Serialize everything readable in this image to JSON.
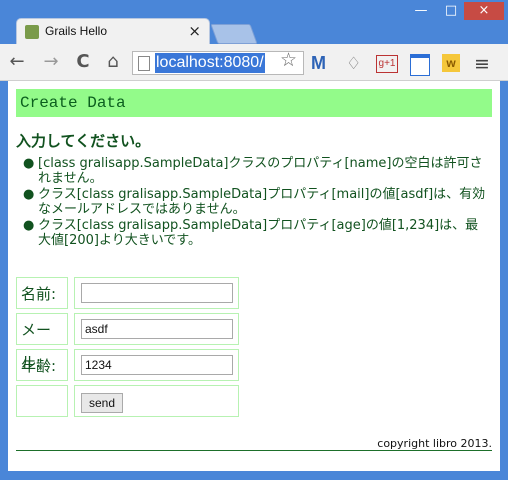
{
  "browser": {
    "tab_title": "Grails Hello",
    "url": "localhost:8080/",
    "menu_labels": {
      "back": "←",
      "forward": "→",
      "reload": "C",
      "home": "⌂",
      "star": "☆",
      "mail": "M",
      "bell": "♢",
      "gplus": "g+1",
      "w": "w",
      "menu": "≡"
    }
  },
  "page": {
    "header": "Create Data",
    "instruction": "入力してください。",
    "errors": [
      "[class gralisapp.SampleData]クラスのプロパティ[name]の空白は許可されません。",
      "クラス[class gralisapp.SampleData]プロパティ[mail]の値[asdf]は、有効なメールアドレスではありません。",
      "クラス[class gralisapp.SampleData]プロパティ[age]の値[1,234]は、最大値[200]より大きいです。"
    ],
    "form": {
      "name_label": "名前:",
      "mail_label": "メール:",
      "age_label": "年齢:",
      "name_value": "",
      "mail_value": "asdf",
      "age_value": "1234",
      "submit_label": "send"
    },
    "footer": "copyright libro 2013."
  }
}
